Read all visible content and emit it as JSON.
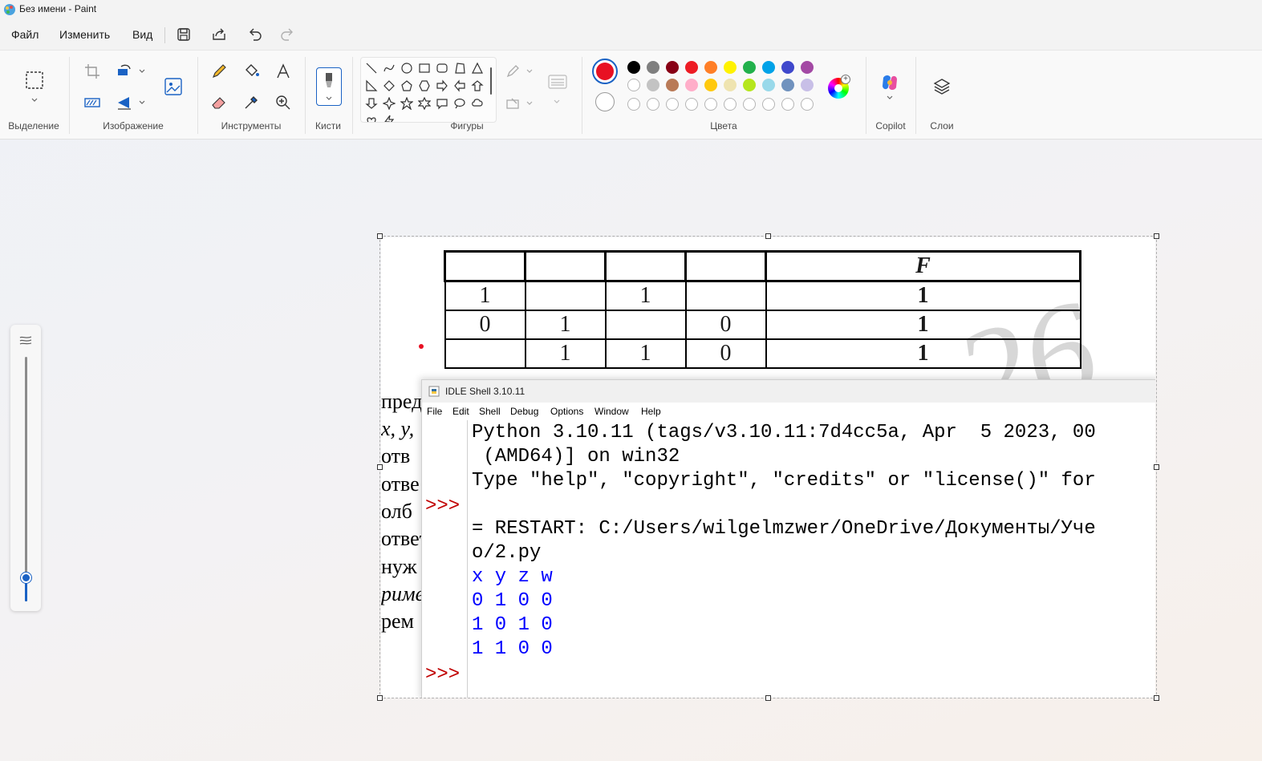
{
  "window": {
    "title": "Без имени - Paint"
  },
  "menubar": {
    "file": "Файл",
    "edit": "Изменить",
    "view": "Вид"
  },
  "ribbon": {
    "groups": {
      "selection": "Выделение",
      "image": "Изображение",
      "tools": "Инструменты",
      "brushes": "Кисти",
      "shapes": "Фигуры",
      "colors": "Цвета",
      "copilot": "Copilot",
      "layers": "Слои"
    },
    "colors": {
      "primary": "#e81123",
      "secondary": "#ffffff",
      "row1": [
        "#000000",
        "#7f7f7f",
        "#880015",
        "#ed1c24",
        "#ff7f27",
        "#fff200",
        "#22b14c",
        "#00a2e8",
        "#3f48cc",
        "#a349a4"
      ],
      "row2": [
        "#ffffff",
        "#c3c3c3",
        "#b97a57",
        "#ffaec9",
        "#ffc90e",
        "#efe4b0",
        "#b5e61d",
        "#99d9ea",
        "#7092be",
        "#c8bfe7"
      ]
    }
  },
  "zoom": {
    "level_fraction": 0.1
  },
  "canvas": {
    "truth_table": {
      "header": [
        "",
        "",
        "",
        "",
        "F"
      ],
      "rows": [
        [
          "1",
          "",
          "1",
          "",
          "1"
        ],
        [
          "0",
          "1",
          "",
          "0",
          "1"
        ],
        [
          "",
          "1",
          "1",
          "0",
          "1"
        ]
      ]
    },
    "watermark": "26",
    "side_text": [
      "пред",
      "x, y,",
      " отв",
      "отве",
      "олб",
      "ответ",
      " нуж",
      "риме",
      "рем"
    ]
  },
  "idle": {
    "title": "IDLE Shell 3.10.11",
    "menu": [
      "File",
      "Edit",
      "Shell",
      "Debug",
      "Options",
      "Window",
      "Help"
    ],
    "prompt": ">>>",
    "lines": [
      "Python 3.10.11 (tags/v3.10.11:7d4cc5a, Apr  5 2023, 00",
      " (AMD64)] on win32",
      "Type \"help\", \"copyright\", \"credits\" or \"license()\" for",
      "",
      "= RESTART: C:/Users/wilgelmzwer/OneDrive/Документы/Уче",
      "o/2.py"
    ],
    "output": [
      "x y z w",
      "0 1 0 0",
      "1 0 1 0",
      "1 1 0 0"
    ]
  }
}
